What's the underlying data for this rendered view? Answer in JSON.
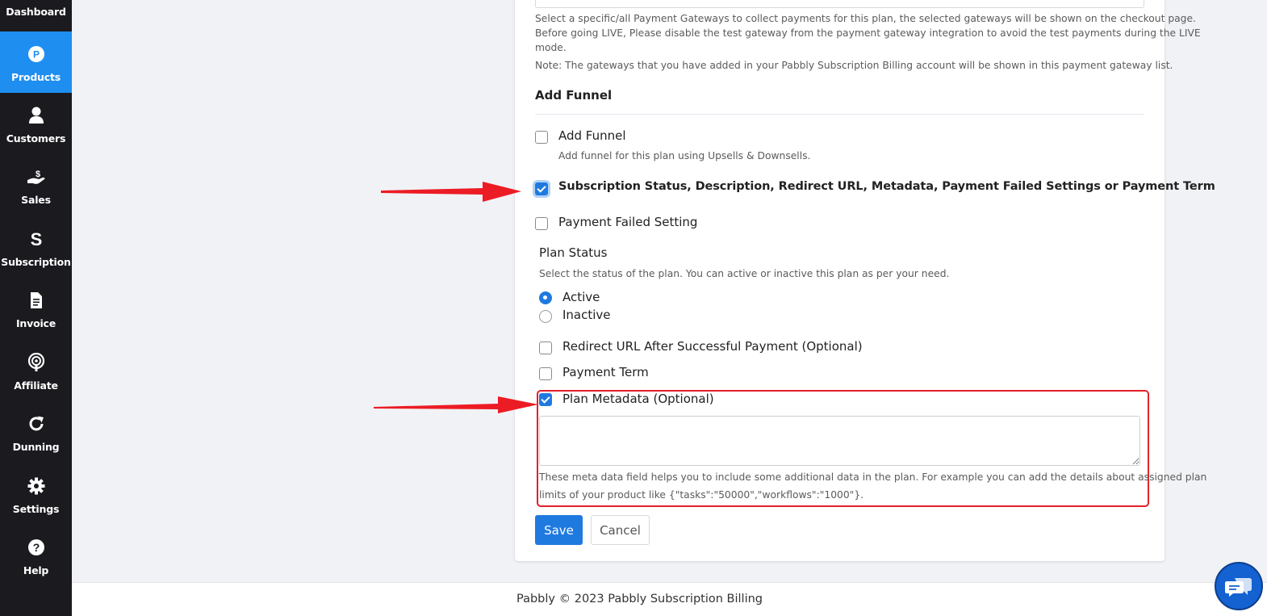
{
  "sidebar": {
    "items": [
      {
        "label": "Dashboard",
        "icon": "dashboard-icon"
      },
      {
        "label": "Products",
        "icon": "products-icon",
        "active": true
      },
      {
        "label": "Customers",
        "icon": "user-icon"
      },
      {
        "label": "Sales",
        "icon": "sales-icon"
      },
      {
        "label": "Subscription",
        "icon": "subscription-icon"
      },
      {
        "label": "Invoice",
        "icon": "invoice-icon"
      },
      {
        "label": "Affiliate",
        "icon": "affiliate-icon"
      },
      {
        "label": "Dunning",
        "icon": "refresh-icon"
      },
      {
        "label": "Settings",
        "icon": "gear-icon"
      },
      {
        "label": "Help",
        "icon": "help-icon"
      }
    ]
  },
  "gateway": {
    "help_line1": "Select a specific/all Payment Gateways to collect payments for this plan, the selected gateways will be shown on the checkout page.",
    "help_line2": "Before going LIVE, Please disable the test gateway from the payment gateway integration to avoid the test payments during the LIVE",
    "help_line3": "mode.",
    "note": "Note: The gateways that you have added in your Pabbly Subscription Billing account will be shown in this payment gateway list."
  },
  "funnel": {
    "heading": "Add Funnel",
    "add_funnel_label": "Add Funnel",
    "add_funnel_help": "Add funnel for this plan using Upsells & Downsells.",
    "add_funnel_checked": false,
    "advanced_label": "Subscription Status, Description, Redirect URL, Metadata, Payment Failed Settings or Payment Term",
    "advanced_checked": true,
    "payment_failed_label": "Payment Failed Setting",
    "payment_failed_checked": false
  },
  "plan_status": {
    "heading": "Plan Status",
    "help": "Select the status of the plan. You can active or inactive this plan as per your need.",
    "options": [
      "Active",
      "Inactive"
    ],
    "selected": "Active"
  },
  "redirect": {
    "label": "Redirect URL After Successful Payment (Optional)",
    "checked": false
  },
  "payment_term": {
    "label": "Payment Term",
    "checked": false
  },
  "metadata": {
    "label": "Plan Metadata (Optional)",
    "checked": true,
    "value": "",
    "help_line1": "These meta data field helps you to include some additional data in the plan. For example you can add the details about assigned plan",
    "help_line2": "limits of your product like {\"tasks\":\"50000\",\"workflows\":\"1000\"}."
  },
  "actions": {
    "save": "Save",
    "cancel": "Cancel"
  },
  "footer": {
    "text": "Pabbly © 2023 Pabbly Subscription Billing"
  },
  "colors": {
    "primary": "#1f7ae0",
    "sidebar_bg": "#1a1a1f",
    "sidebar_active": "#1f8ef1",
    "highlight": "#e5202a"
  }
}
